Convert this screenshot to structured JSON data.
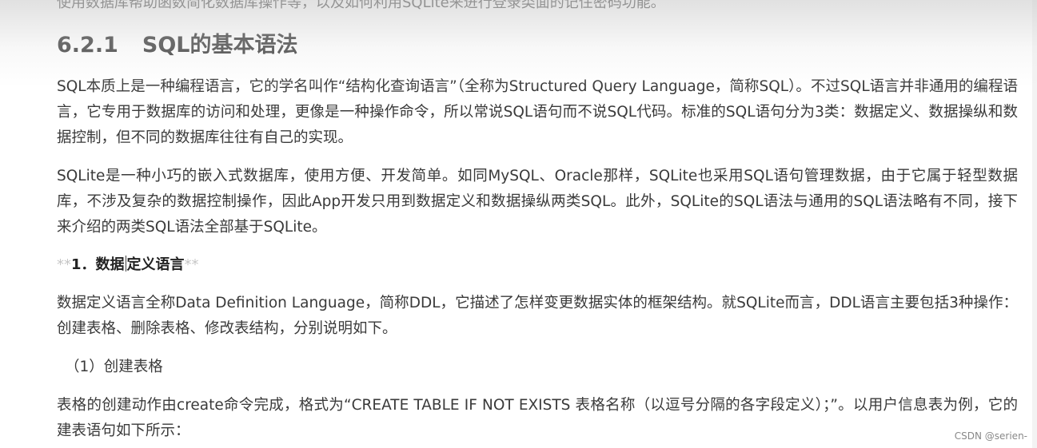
{
  "doc": {
    "cut_line": "使用数据库帮助函数简化数据库操作等，以及如何利用SQLite来进行登录类面的记住密码功能。",
    "section_number": "6.2.1",
    "section_title": "SQL的基本语法",
    "paragraph1": "SQL本质上是一种编程语言，它的学名叫作“结构化查询语言”（全称为Structured Query Language，简称SQL）。不过SQL语言并非通用的编程语言，它专用于数据库的访问和处理，更像是一种操作命令，所以常说SQL语句而不说SQL代码。标准的SQL语句分为3类：数据定义、数据操纵和数据控制，但不同的数据库往往有自己的实现。",
    "paragraph2": "SQLite是一种小巧的嵌入式数据库，使用方便、开发简单。如同MySQL、Oracle那样，SQLite也采用SQL语句管理数据，由于它属于轻型数据库，不涉及复杂的数据控制操作，因此App开发只用到数据定义和数据操纵两类SQL。此外，SQLite的SQL语法与通用的SQL语法略有不同，接下来介绍的两类SQL语法全部基于SQLite。",
    "subheading_md_open": "**",
    "subheading_part1": "1．数据",
    "subheading_part2": "定义语言",
    "subheading_md_close": "**",
    "paragraph3": "数据定义语言全称Data Definition Language，简称DDL，它描述了怎样变更数据实体的框架结构。就SQLite而言，DDL语言主要包括3种操作：创建表格、删除表格、修改表结构，分别说明如下。",
    "step1": "（1）创建表格",
    "paragraph4": "表格的创建动作由create命令完成，格式为“CREATE TABLE IF NOT EXISTS 表格名称（以逗号分隔的各字段定义）；”。以用户信息表为例，它的建表语句如下所示："
  },
  "watermark": "CSDN @serien-"
}
